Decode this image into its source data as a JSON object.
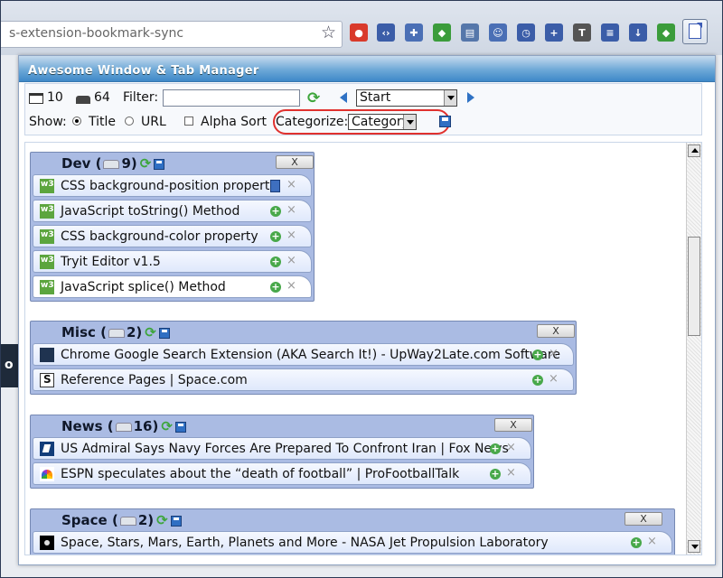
{
  "browser": {
    "url_fragment": "s-extension-bookmark-sync",
    "extensions": [
      {
        "icon": "chrome-icon",
        "color": "#d93a2b"
      },
      {
        "icon": "code-icon",
        "color": "#3b5da8"
      },
      {
        "icon": "puzzle-icon",
        "color": "#4a6fb5"
      },
      {
        "icon": "maps-icon",
        "color": "#3b9c3b"
      },
      {
        "icon": "print-icon",
        "color": "#5577aa"
      },
      {
        "icon": "person-icon",
        "color": "#4a6fb5"
      },
      {
        "icon": "clock-icon",
        "color": "#3b5da8"
      },
      {
        "icon": "plus-icon",
        "color": "#3b5da8"
      },
      {
        "icon": "tag-icon",
        "color": "#555555"
      },
      {
        "icon": "layers-icon",
        "color": "#3b5da8"
      },
      {
        "icon": "download-icon",
        "color": "#3b5da8"
      },
      {
        "icon": "maps-icon",
        "color": "#3b9c3b"
      }
    ]
  },
  "popup": {
    "title": "Awesome Window & Tab Manager",
    "window_count": "10",
    "tab_count": "64",
    "filter_label": "Filter:",
    "filter_value": "",
    "start_option": "Start",
    "show_label": "Show:",
    "title_option": "Title",
    "url_option": "URL",
    "alpha_sort_label": "Alpha Sort",
    "categorize_label": "Categorize:",
    "category_option": "Category",
    "show_title_selected": true,
    "alpha_sort_checked": false
  },
  "groups": [
    {
      "name": "Dev (",
      "count": "9)",
      "close_label": "X",
      "tabs": [
        {
          "title": "CSS background-position property",
          "favicon": "w3",
          "action": "bookmark"
        },
        {
          "title": "JavaScript toString() Method",
          "favicon": "w3",
          "action": "add"
        },
        {
          "title": "CSS background-color property",
          "favicon": "w3",
          "action": "add"
        },
        {
          "title": "Tryit Editor v1.5",
          "favicon": "w3",
          "action": "add"
        },
        {
          "title": "JavaScript splice() Method",
          "favicon": "w3",
          "action": "add",
          "selected": true
        }
      ]
    },
    {
      "name": "Misc (",
      "count": "2)",
      "close_label": "X",
      "tabs": [
        {
          "title": "Chrome Google Search Extension (AKA Search It!) - UpWay2Late.com Software",
          "favicon": "dark",
          "action": "add"
        },
        {
          "title": "Reference Pages | Space.com",
          "favicon": "s",
          "action": "add"
        }
      ]
    },
    {
      "name": "News (",
      "count": "16)",
      "close_label": "X",
      "tabs": [
        {
          "title": "US Admiral Says Navy Forces Are Prepared To Confront Iran | Fox News",
          "favicon": "fox",
          "action": "add"
        },
        {
          "title": "ESPN speculates about the “death of football” | ProFootballTalk",
          "favicon": "nbc",
          "action": "add"
        }
      ]
    },
    {
      "name": "Space (",
      "count": "2)",
      "close_label": "X",
      "tabs": [
        {
          "title": "Space, Stars, Mars, Earth, Planets and More - NASA Jet Propulsion Laboratory",
          "favicon": "space",
          "action": "add"
        }
      ]
    }
  ],
  "colors": {
    "header_blue": "#3e88c8",
    "group_bg": "#aabbe3",
    "highlight_red": "#e0312e"
  }
}
